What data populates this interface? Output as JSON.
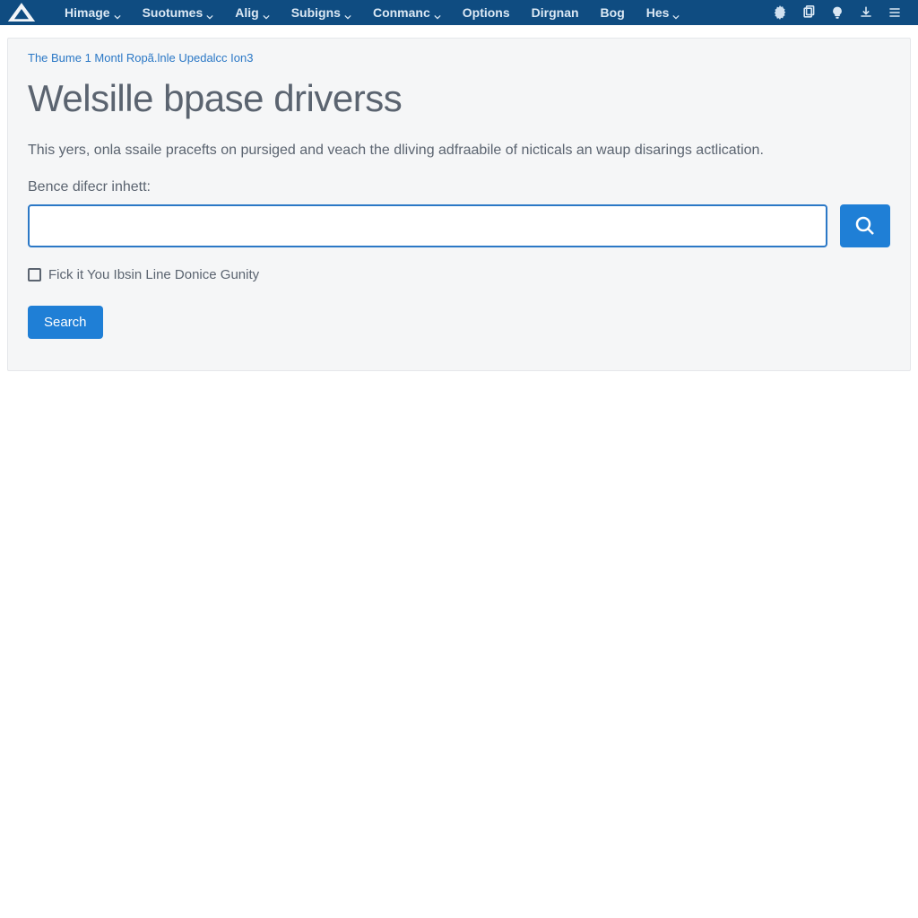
{
  "nav": {
    "items": [
      {
        "label": "Himage",
        "has_chevron": true
      },
      {
        "label": "Suotumes",
        "has_chevron": true
      },
      {
        "label": "Alig",
        "has_chevron": true
      },
      {
        "label": "Subigns",
        "has_chevron": true
      },
      {
        "label": "Conmanc",
        "has_chevron": true
      },
      {
        "label": "Options",
        "has_chevron": false
      },
      {
        "label": "Dirgnan",
        "has_chevron": false
      },
      {
        "label": "Bog",
        "has_chevron": false
      },
      {
        "label": "Hes",
        "has_chevron": true
      }
    ]
  },
  "breadcrumb": {
    "text": "The Bume 1 Montl Ropã.lnle Upedalcc Ion3"
  },
  "page": {
    "title": "Welsille bpase driverss",
    "intro": "This yers, onla ssaile pracefts on pursiged and veach the dliving adfraabile of nicticals an waup disarings actlication.",
    "form_label": "Bence difecr inhett:",
    "checkbox_label": "Fick it You Ibsin Line Donice Gunity",
    "search_button": "Search"
  },
  "search": {
    "value": "",
    "placeholder": ""
  },
  "colors": {
    "brand": "#0f4c81",
    "accent": "#1f7fd6",
    "link": "#2b78c6",
    "text": "#5b6470"
  }
}
